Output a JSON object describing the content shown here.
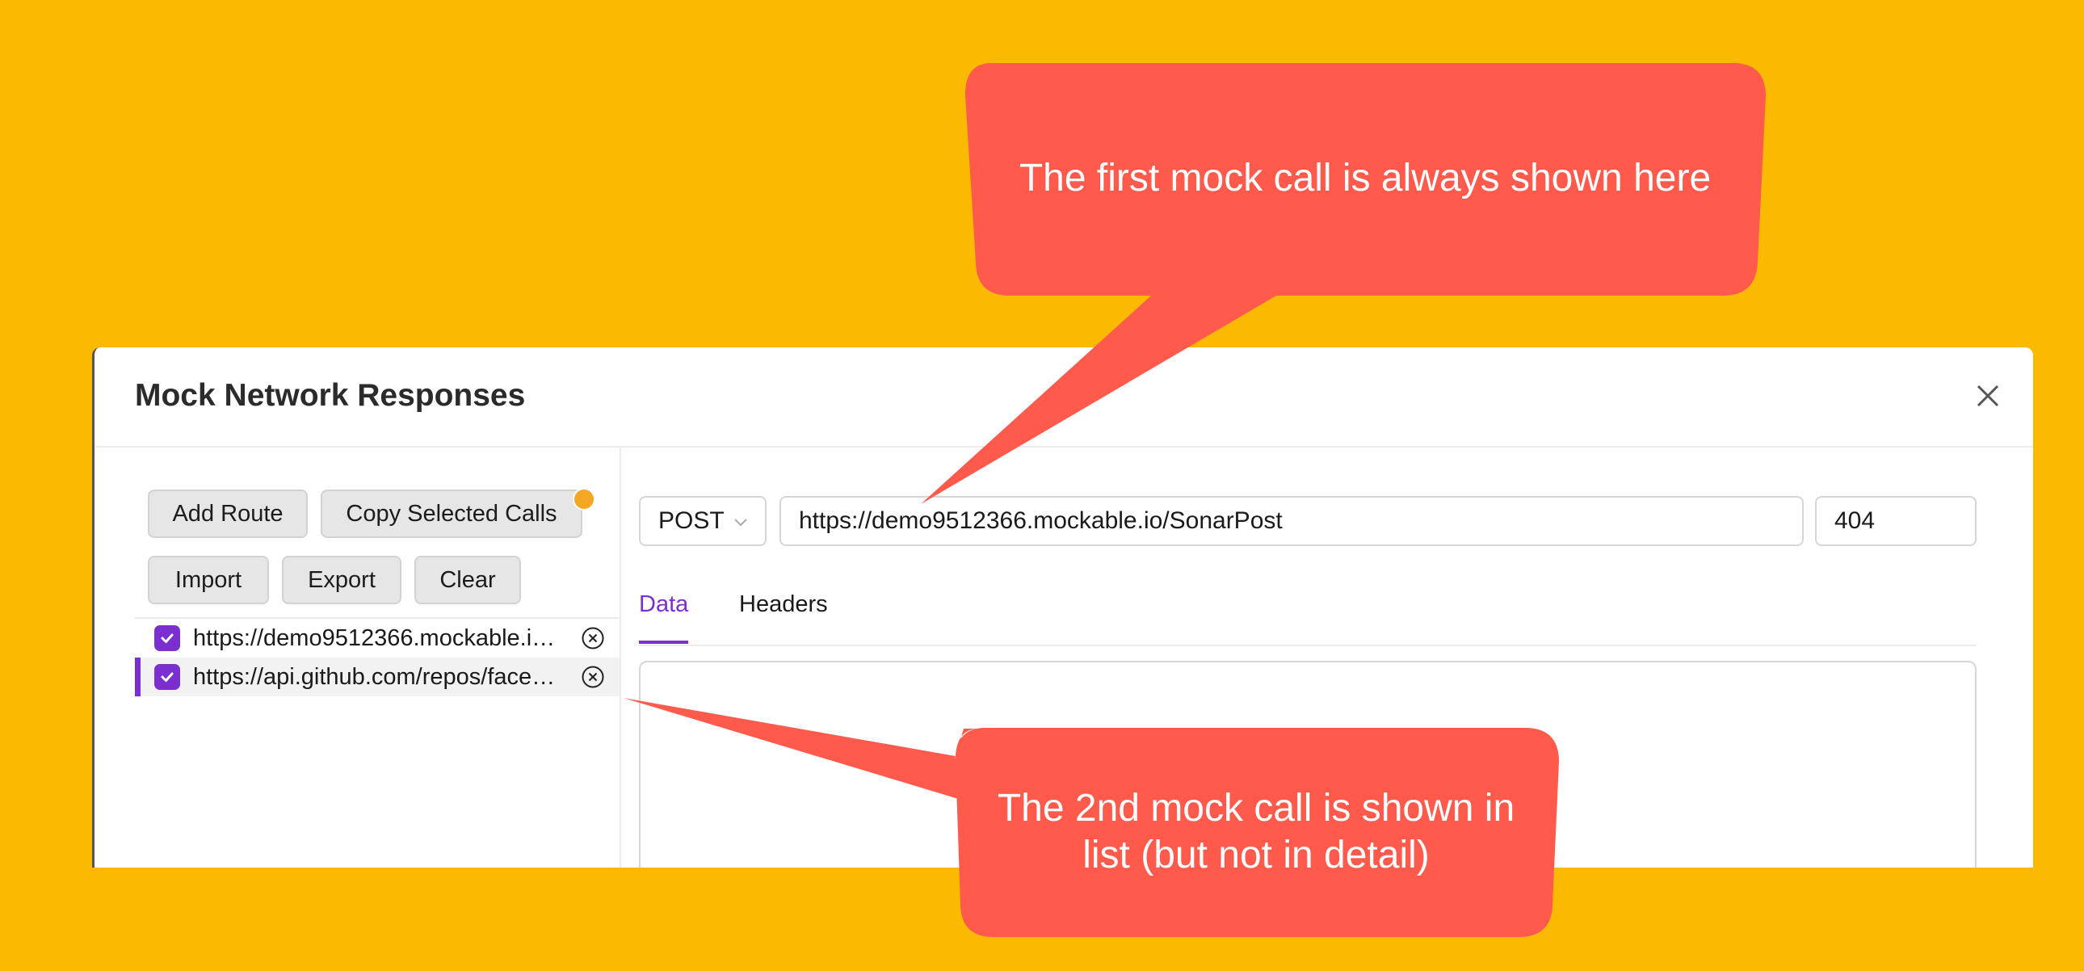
{
  "modal": {
    "title": "Mock Network Responses"
  },
  "toolbar": {
    "add_route": "Add Route",
    "copy_selected": "Copy Selected Calls",
    "import": "Import",
    "export": "Export",
    "clear": "Clear"
  },
  "routes": [
    {
      "url": "https://demo9512366.mockable.io/SonarPost",
      "checked": true,
      "selected": false
    },
    {
      "url": "https://api.github.com/repos/facebook/flipper",
      "checked": true,
      "selected": true
    }
  ],
  "detail": {
    "method": "POST",
    "url": "https://demo9512366.mockable.io/SonarPost",
    "status": "404",
    "tabs": [
      "Data",
      "Headers"
    ],
    "active_tab": "Data"
  },
  "callouts": {
    "first": "The first mock call is always shown here",
    "second_line1": "The 2nd mock call is shown in",
    "second_line2": "list (but not in detail)"
  },
  "colors": {
    "background": "#FBBA00",
    "callout": "#FF5A4C",
    "accent": "#7B2FD1",
    "badge": "#F5A623"
  }
}
